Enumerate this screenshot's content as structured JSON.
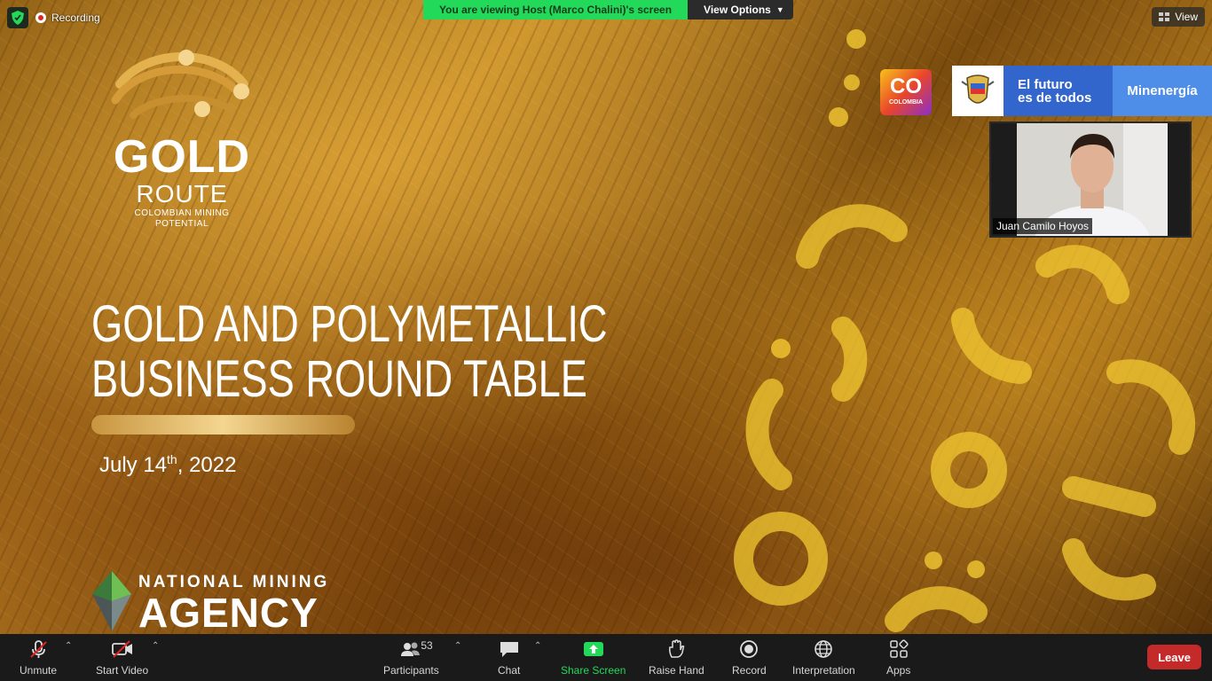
{
  "meeting": {
    "recording_label": "Recording",
    "banner_message": "You are viewing Host (Marco Chalini)'s screen",
    "view_options_label": "View Options",
    "view_label": "View"
  },
  "slide": {
    "logo_gold": "GOLD",
    "logo_route": "ROUTE",
    "logo_tagline_1": "COLOMBIAN MINING",
    "logo_tagline_2": "POTENTIAL",
    "headline_1": "GOLD AND POLYMETALLIC",
    "headline_2": "BUSINESS ROUND TABLE",
    "date_pre": "July 14",
    "date_sup": "th",
    "date_post": ", 2022",
    "agency_top": "NATIONAL MINING",
    "agency_bottom": "AGENCY",
    "co_logo": "CO",
    "co_sub": "COLOMBIA",
    "gov_futuro_1": "El futuro",
    "gov_futuro_2": "es de todos",
    "gov_ministry": "Minenergía"
  },
  "participant_tile": {
    "name": "Juan Camilo Hoyos"
  },
  "toolbar": {
    "unmute": "Unmute",
    "start_video": "Start Video",
    "participants": "Participants",
    "participants_count": "53",
    "chat": "Chat",
    "share_screen": "Share Screen",
    "raise_hand": "Raise Hand",
    "record": "Record",
    "interpretation": "Interpretation",
    "apps": "Apps",
    "leave": "Leave"
  },
  "colors": {
    "banner_green": "#23d959",
    "leave_red": "#c52a2a",
    "toolbar_bg": "#1a1a1a"
  }
}
